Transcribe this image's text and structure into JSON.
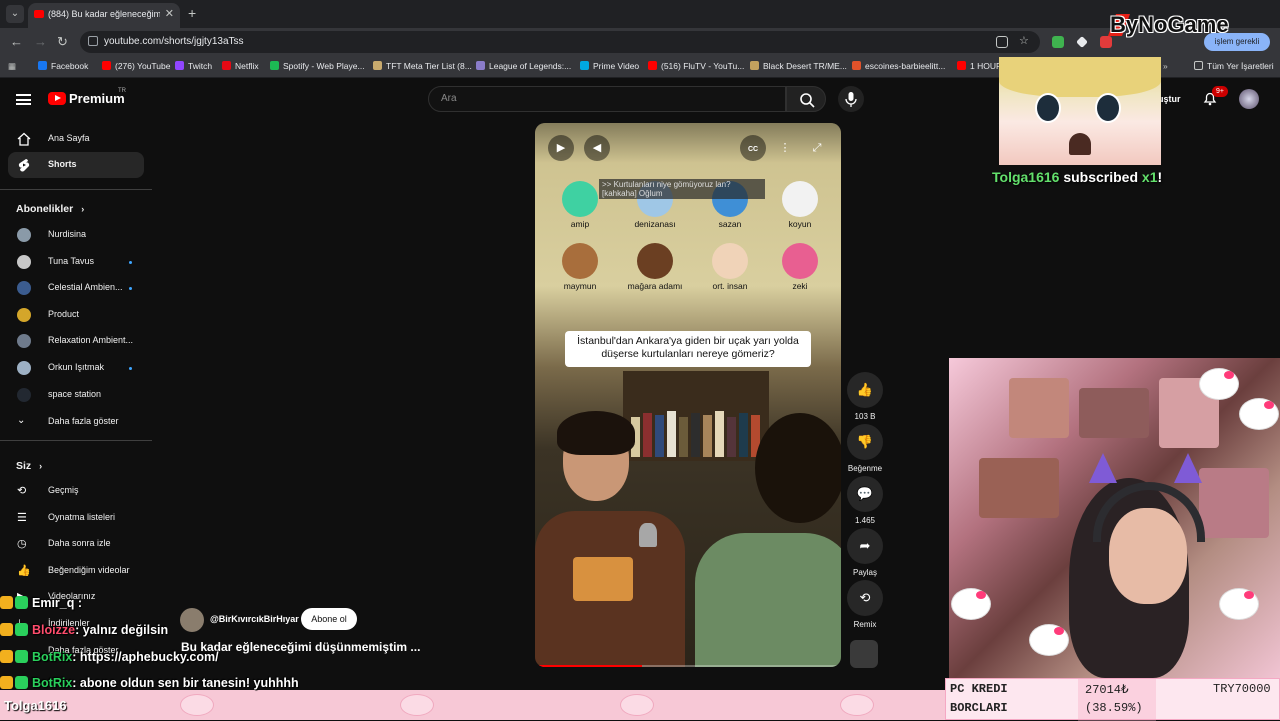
{
  "browser": {
    "tab_title": "(884) Bu kadar eğleneceğimi dü",
    "url": "youtube.com/shorts/jgjty13aTss",
    "profile_label": "işlem gerekli",
    "bookmarks": [
      {
        "label": "Facebook",
        "color": "#1877f2"
      },
      {
        "label": "(276) YouTube",
        "color": "#ff0000"
      },
      {
        "label": "Twitch",
        "color": "#9146ff"
      },
      {
        "label": "Netflix",
        "color": "#e50914"
      },
      {
        "label": "Spotify - Web Playe...",
        "color": "#1db954"
      },
      {
        "label": "TFT Meta Tier List (8...",
        "color": "#c8aa6e"
      },
      {
        "label": "League of Legends:...",
        "color": "#8a7cc9"
      },
      {
        "label": "Prime Video",
        "color": "#00a8e1"
      },
      {
        "label": "(516) FluTV - YouTu...",
        "color": "#ff0000"
      },
      {
        "label": "Black Desert TR/ME...",
        "color": "#c2a15e"
      },
      {
        "label": "escoines-barbieelitt...",
        "color": "#e0522a"
      },
      {
        "label": "1 HOUR",
        "color": "#ff0000"
      }
    ],
    "bookmarks_all": "Tüm Yer İşaretleri"
  },
  "youtube": {
    "logo_label": "Premium",
    "logo_region": "TR",
    "search_placeholder": "Ara",
    "header_create_partial": "uştur",
    "notification_count": "9+",
    "sidebar": {
      "top_items": [
        {
          "label": "Ana Sayfa",
          "icon": "home-icon"
        },
        {
          "label": "Shorts",
          "icon": "shorts-icon"
        }
      ],
      "subscriptions_title": "Abonelikler",
      "subscriptions": [
        {
          "label": "Nurdisina",
          "color": "#8a9aa8",
          "dot": false
        },
        {
          "label": "Tuna Tavus",
          "color": "#c7c7c7",
          "dot": true
        },
        {
          "label": "Celestial Ambien...",
          "color": "#3b5c8f",
          "dot": true
        },
        {
          "label": "Product",
          "color": "#d4a62a",
          "dot": false
        },
        {
          "label": "Relaxation Ambient...",
          "color": "#6f7b8c",
          "dot": false
        },
        {
          "label": "Orkun Işıtmak",
          "color": "#9db0c4",
          "dot": true
        },
        {
          "label": "space station",
          "color": "#222831",
          "dot": false
        }
      ],
      "show_more": "Daha fazla göster",
      "you_title": "Siz",
      "you_items": [
        {
          "label": "Geçmiş",
          "icon": "history-icon"
        },
        {
          "label": "Oynatma listeleri",
          "icon": "playlist-icon"
        },
        {
          "label": "Daha sonra izle",
          "icon": "clock-icon"
        },
        {
          "label": "Beğendiğim videolar",
          "icon": "like-icon"
        },
        {
          "label": "Videolarınız",
          "icon": "video-icon"
        },
        {
          "label": "İndirilenler",
          "icon": "download-icon"
        },
        {
          "label": "Daha fazla göster",
          "icon": "chevron-down-icon"
        }
      ]
    },
    "short": {
      "caption_overlay": ">> Kurtulanları niye gömüyoruz lan? [kahkaha] Oğlum",
      "emoji_labels": [
        "amip",
        "denizanası",
        "sazan",
        "koyun",
        "maymun",
        "mağara adamı",
        "ort. insan",
        "zeki"
      ],
      "question": "İstanbul'dan Ankara'ya giden bir uçak yarı yolda düşerse kurtulanları nereye gömeriz?",
      "channel": "@BirKıvırcıkBirHıyar",
      "subscribe_label": "Abone ol",
      "title": "Bu kadar eğleneceğimi düşünmemiştim ...",
      "progress": 0.35,
      "actions": [
        {
          "name": "like",
          "count": "103 B",
          "glyph": "👍"
        },
        {
          "name": "dislike",
          "count": "Beğenme",
          "glyph": "👎"
        },
        {
          "name": "comments",
          "count": "1.465",
          "glyph": "💬"
        },
        {
          "name": "share",
          "count": "Paylaş",
          "glyph": "➦"
        },
        {
          "name": "remix",
          "count": "Remix",
          "glyph": "⟲"
        }
      ]
    }
  },
  "stream": {
    "brand": "ByNoGame",
    "sub_alert": {
      "user": "Tolga1616",
      "text": " subscribed ",
      "count": "x1",
      "tail": "!"
    },
    "chat": [
      {
        "user": "Emir_q",
        "msg": " :",
        "color": "#ffffff"
      },
      {
        "user": "Bloizze",
        "msg": ": yalnız değilsin",
        "color": "#ff4d6d"
      },
      {
        "user": "BotRix",
        "msg": ": https://aphebucky.com/",
        "color": "#2ad05c"
      },
      {
        "user": "BotRix",
        "msg": ": abone oldun sen bir tanesin! yuhhhh",
        "color": "#2ad05c"
      }
    ],
    "bottom_name": "Tolga1616",
    "goal": {
      "label1": "PC KREDI",
      "label2": "BORCLARI",
      "amount": "27014₺",
      "percent_text": "(38.59%)",
      "percent": 0.3859,
      "target": "TRY70000"
    }
  }
}
